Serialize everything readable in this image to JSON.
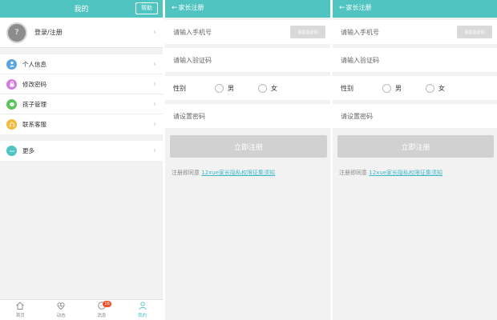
{
  "colors": {
    "accent": "#4fc4c0",
    "badge": "#f0522b",
    "link": "#3fb8c8"
  },
  "panel1": {
    "title": "我的",
    "help_label": "帮助",
    "login_label": "登录/注册",
    "menu": [
      {
        "label": "个人信息",
        "icon": "user-icon",
        "color": "#5aa5e0"
      },
      {
        "label": "修改密码",
        "icon": "lock-icon",
        "color": "#d67be0"
      },
      {
        "label": "孩子管理",
        "icon": "child-icon",
        "color": "#5cc45a"
      },
      {
        "label": "联系客服",
        "icon": "service-icon",
        "color": "#f4b93c"
      }
    ],
    "more": {
      "label": "更多",
      "icon": "more-icon",
      "color": "#4fc4c0"
    },
    "tabs": [
      {
        "label": "首页",
        "icon": "home-icon"
      },
      {
        "label": "动态",
        "icon": "activity-icon"
      },
      {
        "label": "消息",
        "icon": "message-icon",
        "badge": "16"
      },
      {
        "label": "我的",
        "icon": "profile-icon",
        "active": true
      }
    ]
  },
  "register": {
    "title": "家长注册",
    "phone_placeholder": "请输入手机号",
    "get_code_label": "获取验证码",
    "code_placeholder": "请输入验证码",
    "gender_label": "性别",
    "male_label": "男",
    "female_label": "女",
    "password_placeholder": "请设置密码",
    "submit_label": "立即注册",
    "agree_prefix": "注册即同意",
    "agree_link": "12xue家长隐私权限征集须知"
  }
}
